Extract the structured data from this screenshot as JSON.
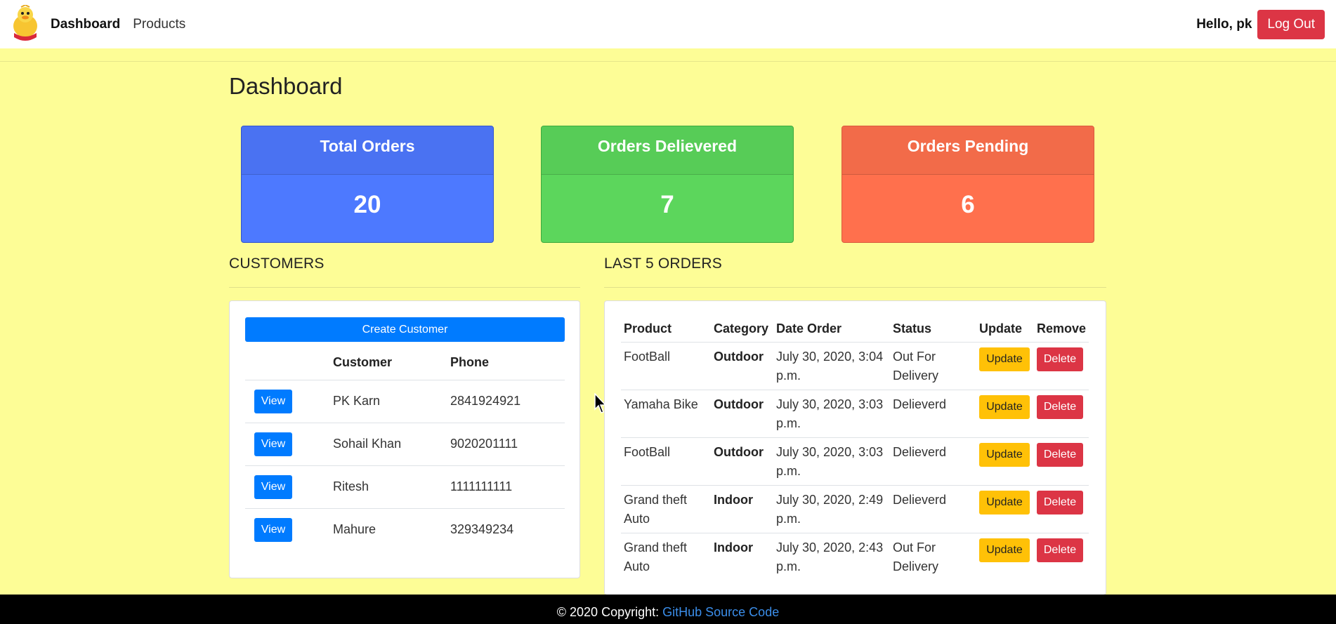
{
  "navbar": {
    "links": [
      "Dashboard",
      "Products"
    ],
    "greeting": "Hello, pk",
    "logout_label": "Log Out"
  },
  "page_title": "Dashboard",
  "stats": [
    {
      "label": "Total Orders",
      "value": "20",
      "color": "#4d79ff"
    },
    {
      "label": "Orders Delievered",
      "value": "7",
      "color": "#5cd65c"
    },
    {
      "label": "Orders Pending",
      "value": "6",
      "color": "#ff704d"
    }
  ],
  "customers": {
    "title": "CUSTOMERS",
    "create_label": "Create Customer",
    "headers": [
      "",
      "Customer",
      "Phone"
    ],
    "view_label": "View",
    "rows": [
      {
        "name": "PK Karn",
        "phone": "2841924921"
      },
      {
        "name": "Sohail Khan",
        "phone": "9020201111"
      },
      {
        "name": "Ritesh",
        "phone": "1111111111"
      },
      {
        "name": "Mahure",
        "phone": "329349234"
      }
    ]
  },
  "orders": {
    "title": "LAST 5 ORDERS",
    "headers": [
      "Product",
      "Category",
      "Date Order",
      "Status",
      "Update",
      "Remove"
    ],
    "update_label": "Update",
    "delete_label": "Delete",
    "rows": [
      {
        "product": "FootBall",
        "category": "Outdoor",
        "date": "July 30, 2020, 3:04 p.m.",
        "status": "Out For Delivery"
      },
      {
        "product": "Yamaha Bike",
        "category": "Outdoor",
        "date": "July 30, 2020, 3:03 p.m.",
        "status": "Delieverd"
      },
      {
        "product": "FootBall",
        "category": "Outdoor",
        "date": "July 30, 2020, 3:03 p.m.",
        "status": "Delieverd"
      },
      {
        "product": "Grand theft Auto",
        "category": "Indoor",
        "date": "July 30, 2020, 2:49 p.m.",
        "status": "Delieverd"
      },
      {
        "product": "Grand theft Auto",
        "category": "Indoor",
        "date": "July 30, 2020, 2:43 p.m.",
        "status": "Out For Delivery"
      }
    ]
  },
  "footer": {
    "text": "© 2020 Copyright: ",
    "link_label": "GitHub Source Code"
  },
  "colors": {
    "page_bg": "#fdfd96",
    "primary": "#007bff",
    "danger": "#dc3545",
    "warning": "#ffc107"
  }
}
